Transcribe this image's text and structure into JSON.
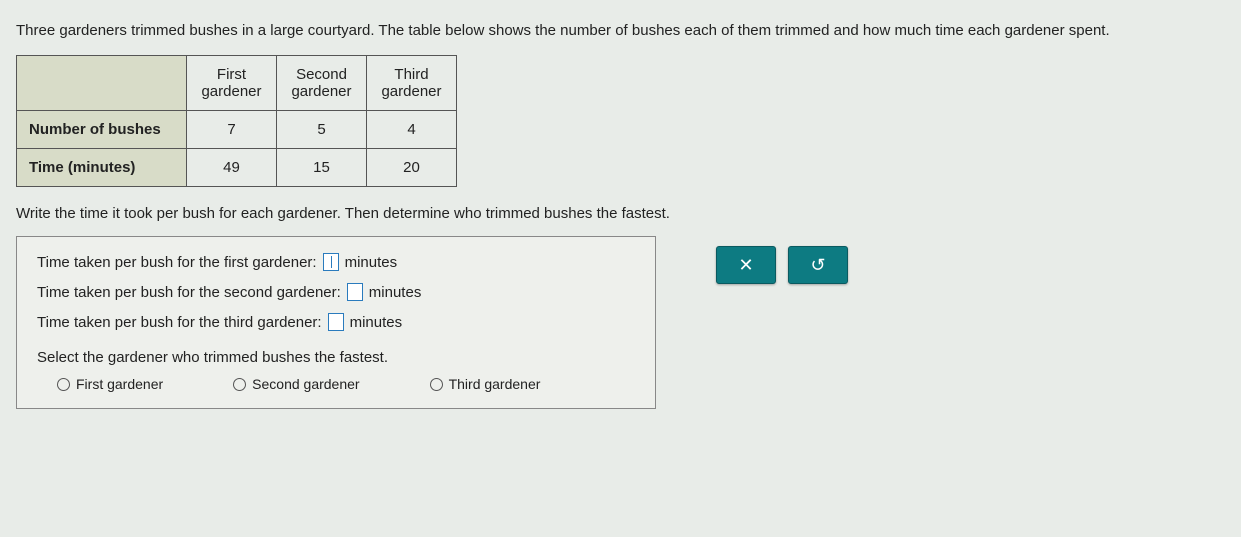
{
  "prompt": "Three gardeners trimmed bushes in a large courtyard. The table below shows the number of bushes each of them trimmed and how much time each gardener spent.",
  "table": {
    "columns": [
      "First gardener",
      "Second gardener",
      "Third gardener"
    ],
    "rows": [
      {
        "label": "Number of bushes",
        "values": [
          "7",
          "5",
          "4"
        ]
      },
      {
        "label": "Time (minutes)",
        "values": [
          "49",
          "15",
          "20"
        ]
      }
    ]
  },
  "instruction": "Write the time it took per bush for each gardener. Then determine who trimmed bushes the fastest.",
  "answers": {
    "line1_pre": "Time taken per bush for the first gardener:",
    "line1_post": "minutes",
    "line2_pre": "Time taken per bush for the second gardener:",
    "line2_post": "minutes",
    "line3_pre": "Time taken per bush for the third gardener:",
    "line3_post": "minutes",
    "select": "Select the gardener who trimmed bushes the fastest.",
    "options": [
      "First gardener",
      "Second gardener",
      "Third gardener"
    ]
  },
  "buttons": {
    "close": "✕",
    "reset": "↺"
  }
}
